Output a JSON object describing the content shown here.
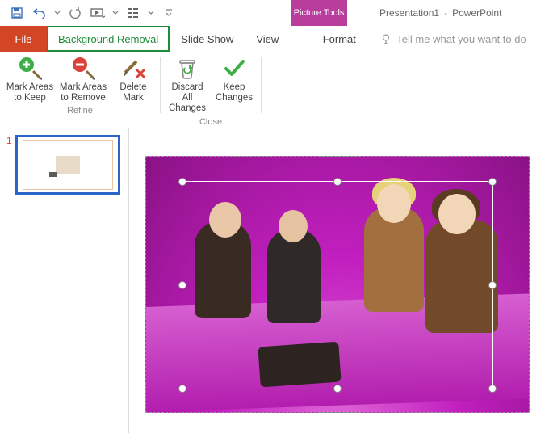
{
  "titlebar": {
    "picture_tools": "Picture Tools",
    "presentation_name": "Presentation1",
    "separator": "-",
    "app_name": "PowerPoint"
  },
  "tabs": {
    "file": "File",
    "background_removal": "Background Removal",
    "slide_show": "Slide Show",
    "view": "View",
    "format": "Format",
    "tell_me_placeholder": "Tell me what you want to do"
  },
  "ribbon": {
    "refine": {
      "mark_keep_l1": "Mark Areas",
      "mark_keep_l2": "to Keep",
      "mark_remove_l1": "Mark Areas",
      "mark_remove_l2": "to Remove",
      "delete_l1": "Delete",
      "delete_l2": "Mark",
      "group_name": "Refine"
    },
    "close": {
      "discard_l1": "Discard All",
      "discard_l2": "Changes",
      "keep_l1": "Keep",
      "keep_l2": "Changes",
      "group_name": "Close"
    }
  },
  "thumbnails": {
    "slide1_num": "1"
  }
}
